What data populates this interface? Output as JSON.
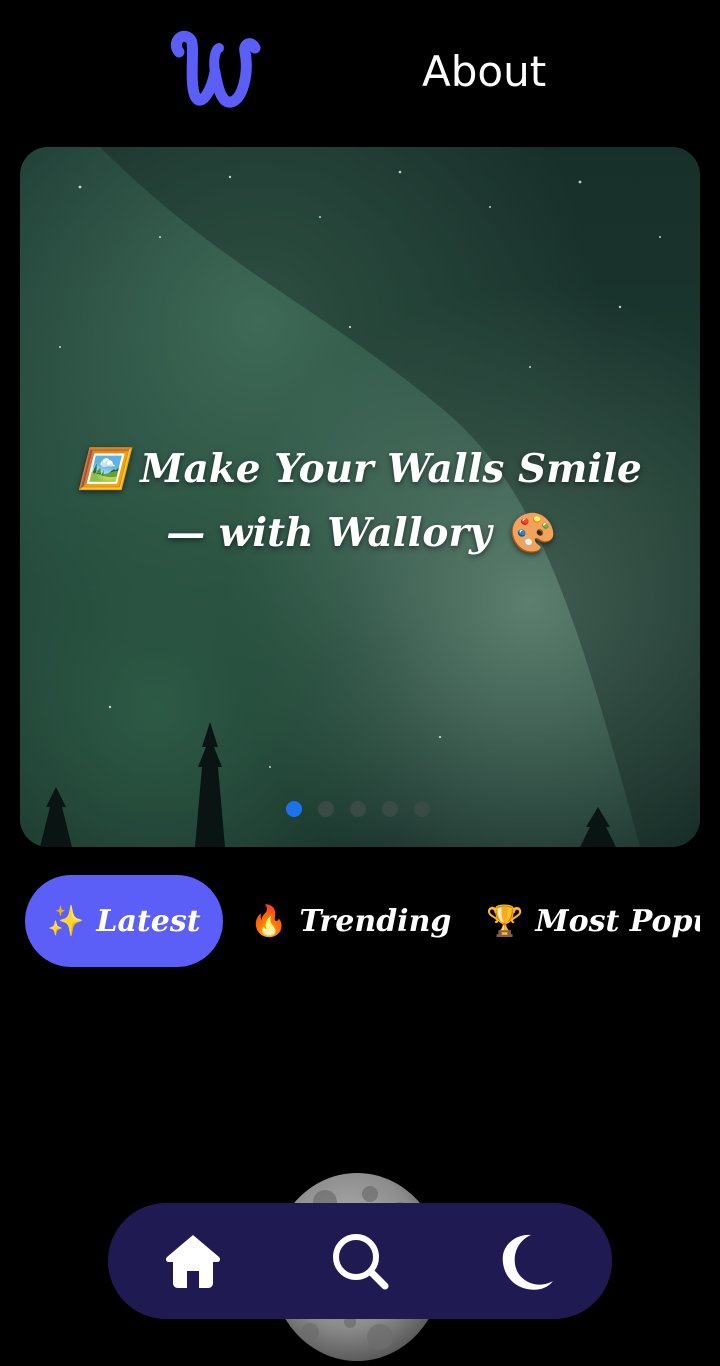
{
  "header": {
    "logo_letter": "W",
    "about_label": "About"
  },
  "hero": {
    "title_line1": "🖼️ Make Your Walls Smile",
    "title_line2": "— with Wallory 🎨",
    "slide_count": 5,
    "active_slide": 1
  },
  "tabs": [
    {
      "emoji": "✨",
      "label": "Latest",
      "active": true
    },
    {
      "emoji": "🔥",
      "label": "Trending",
      "active": false
    },
    {
      "emoji": "🏆",
      "label": "Most Popul",
      "active": false
    }
  ],
  "nav": {
    "items": [
      {
        "icon": "home-icon"
      },
      {
        "icon": "search-icon"
      },
      {
        "icon": "moon-icon"
      }
    ]
  },
  "colors": {
    "background": "#000000",
    "accent": "#5b5ef7",
    "logo": "#5b5ef7",
    "nav_bg": "#201a52",
    "active_dot": "#1a73e8"
  }
}
